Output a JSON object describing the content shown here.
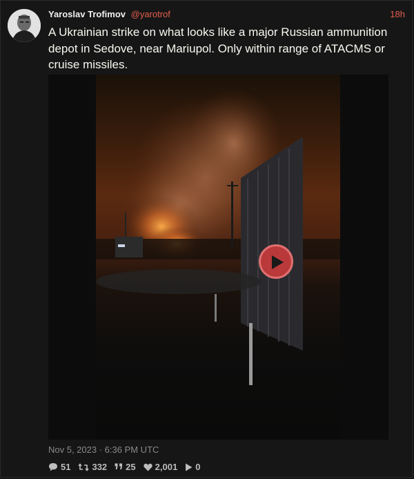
{
  "tweet": {
    "fullname": "Yaroslav Trofimov",
    "username": "@yarotrof",
    "date": "18h",
    "text": "A Ukrainian strike on what looks like a major Russian ammunition depot in Sedove, near Mariupol. Only within range of ATACMS or cruise missiles.",
    "published": "Nov 5, 2023 · 6:36 PM UTC",
    "stats": {
      "replies": "51",
      "retweets": "332",
      "quotes": "25",
      "likes": "2,001",
      "plays": "0"
    }
  },
  "icons": {
    "avatar": "profile-photo",
    "play": "play-icon",
    "reply": "comment-icon",
    "retweet": "retweet-icon",
    "quote": "quote-icon",
    "like": "heart-icon",
    "views": "play-small-icon"
  },
  "colors": {
    "accent": "#e55e4e",
    "background": "#161616",
    "text": "#f8f8f2",
    "muted": "#8a8a8a"
  }
}
